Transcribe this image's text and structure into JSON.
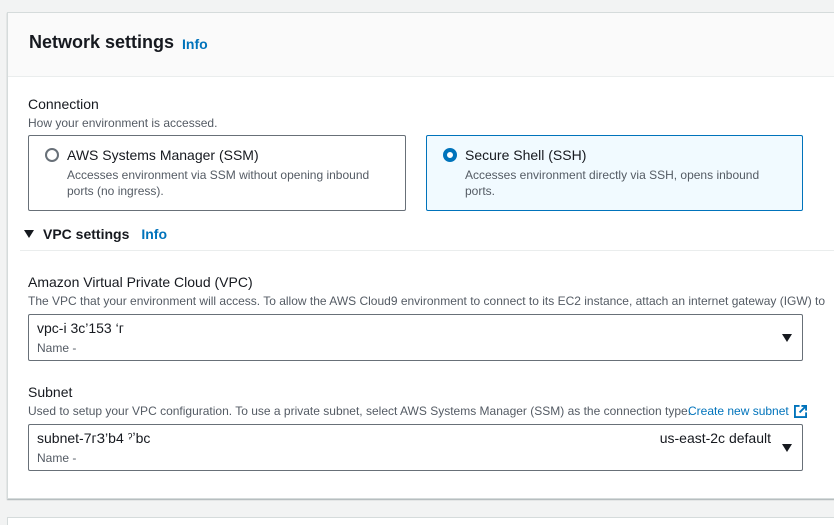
{
  "panel": {
    "title": "Network settings",
    "info": "Info"
  },
  "connection": {
    "label": "Connection",
    "description": "How your environment is accessed.",
    "options": [
      {
        "label": "AWS Systems Manager (SSM)",
        "description": "Accesses environment via SSM without opening inbound ports (no ingress).",
        "selected": false
      },
      {
        "label": "Secure Shell (SSH)",
        "description": "Accesses environment directly via SSH, opens inbound ports.",
        "selected": true
      }
    ]
  },
  "vpc_settings": {
    "label": "VPC settings",
    "info": "Info",
    "expanded": true,
    "vpc": {
      "label": "Amazon Virtual Private Cloud (VPC)",
      "description": "The VPC that your environment will access. To allow the AWS Cloud9 environment to connect to its EC2 instance, attach an internet gateway (IGW) to",
      "value": "vpc-і 3c’153 ‘г",
      "sub": "Name -"
    },
    "subnet": {
      "label": "Subnet",
      "description": "Used to setup your VPC configuration. To use a private subnet, select AWS Systems Manager (SSM) as the connection type.",
      "create_link": "Create new subnet",
      "value": "subnet-7гЗ’b4 ˀʼbc",
      "tag": "us-east-2c default",
      "sub": "Name -"
    }
  },
  "colors": {
    "link": "#0073bb",
    "selected_bg": "#f1faff",
    "border": "#687078"
  }
}
